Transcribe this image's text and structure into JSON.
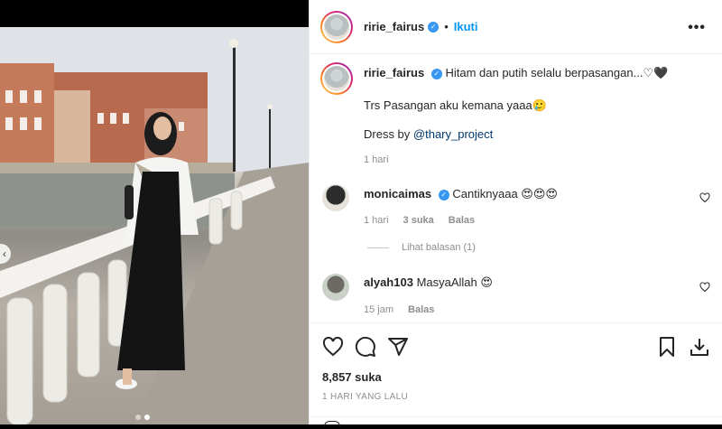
{
  "post": {
    "username": "ririe_fairus",
    "verified_mark": "✓",
    "separator": "•",
    "follow_label": "Ikuti",
    "more_label": "•••",
    "caption_text": "Hitam dan putih selalu berpasangan...♡🖤",
    "caption_line2": "Trs Pasangan aku kemana yaaa🥲",
    "caption_line3_prefix": "Dress by ",
    "caption_mention": "@thary_project",
    "caption_time": "1 hari",
    "likes": "8,857 suka",
    "posted": "1 HARI YANG LALU",
    "carousel": {
      "slides": 2,
      "active": 2
    },
    "prev_arrow": "‹"
  },
  "comments": [
    {
      "username": "monicaimas",
      "verified": true,
      "text": "Cantiknyaaa 😍😍😍",
      "time": "1 hari",
      "likes": "3 suka",
      "reply_label": "Balas",
      "view_replies": "Lihat balasan (1)"
    },
    {
      "username": "alyah103",
      "verified": false,
      "text": "MasyaAllah 😍",
      "time": "15 jam",
      "reply_label": "Balas"
    }
  ],
  "icons": [
    "heart-icon",
    "comment-icon",
    "share-icon",
    "bookmark-icon",
    "download-icon",
    "more-icon",
    "verified-badge-icon",
    "emoji-icon"
  ],
  "colors": {
    "accent": "#0095f6",
    "verified": "#3897f0",
    "muted": "#8e8e8e",
    "text": "#262626"
  }
}
